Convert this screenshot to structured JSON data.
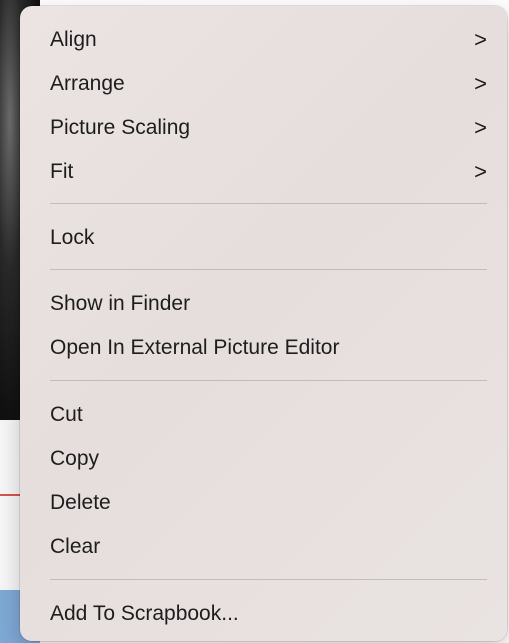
{
  "menu": {
    "groups": [
      {
        "items": [
          {
            "label": "Align",
            "has_submenu": true
          },
          {
            "label": "Arrange",
            "has_submenu": true
          },
          {
            "label": "Picture Scaling",
            "has_submenu": true
          },
          {
            "label": "Fit",
            "has_submenu": true
          }
        ]
      },
      {
        "items": [
          {
            "label": "Lock",
            "has_submenu": false
          }
        ]
      },
      {
        "items": [
          {
            "label": "Show in Finder",
            "has_submenu": false
          },
          {
            "label": "Open In External Picture Editor",
            "has_submenu": false
          }
        ]
      },
      {
        "items": [
          {
            "label": "Cut",
            "has_submenu": false
          },
          {
            "label": "Copy",
            "has_submenu": false
          },
          {
            "label": "Delete",
            "has_submenu": false
          },
          {
            "label": "Clear",
            "has_submenu": false
          }
        ]
      },
      {
        "items": [
          {
            "label": "Add To Scrapbook...",
            "has_submenu": false
          }
        ]
      }
    ],
    "submenu_glyph": ">",
    "icons": {
      "submenu": "chevron-right-icon"
    },
    "colors": {
      "menu_background": "#e9e2e1",
      "text": "#1d1d1d",
      "separator": "#c9c2c1"
    }
  }
}
